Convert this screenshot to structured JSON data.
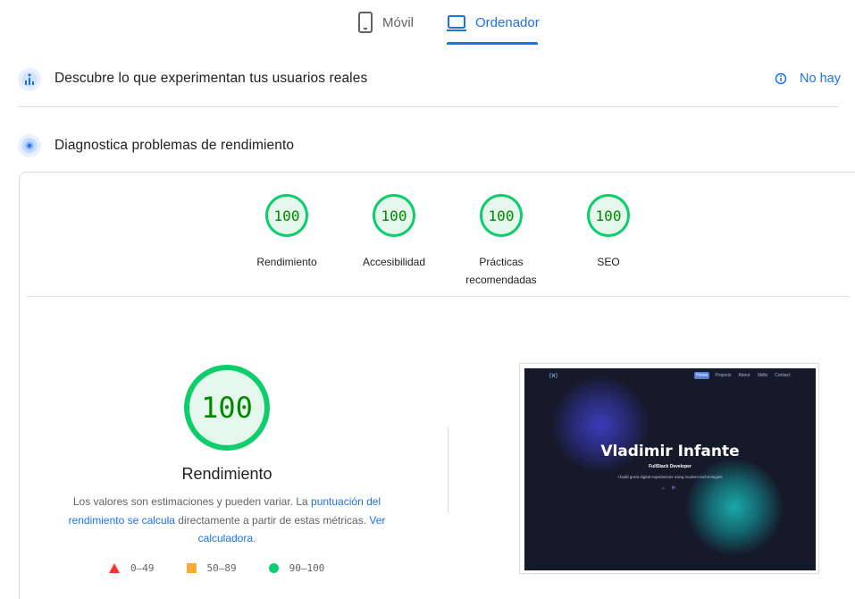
{
  "tabs": {
    "mobile": {
      "label": "Móvil",
      "icon": "smartphone-icon",
      "active": false
    },
    "desktop": {
      "label": "Ordenador",
      "icon": "laptop-icon",
      "active": true
    }
  },
  "crux": {
    "title": "Descubre lo que experimentan tus usuarios reales",
    "icon": "users-chart-icon",
    "nodata_text": "No hay",
    "nodata_icon": "info-icon"
  },
  "diagnose": {
    "title": "Diagnostica problemas de rendimiento",
    "icon": "lighthouse-icon"
  },
  "gauges": [
    {
      "score": "100",
      "label": "Rendimiento"
    },
    {
      "score": "100",
      "label": "Accesibilidad"
    },
    {
      "score": "100",
      "label": "Prácticas recomendadas"
    },
    {
      "score": "100",
      "label": "SEO"
    }
  ],
  "performance": {
    "score": "100",
    "title": "Rendimiento",
    "desc_prefix": "Los valores son estimaciones y pueden variar. La ",
    "desc_link1": "puntuación del rendimiento se calcula",
    "desc_middle": " directamente a partir de estas métricas. ",
    "desc_link2": "Ver calculadora",
    "desc_suffix": "."
  },
  "legend": [
    {
      "range": "0–49",
      "shape": "triangle",
      "color": "#ff3333"
    },
    {
      "range": "50–89",
      "shape": "square",
      "color": "#ffaa33"
    },
    {
      "range": "90–100",
      "shape": "circle",
      "color": "#0cce6b"
    }
  ],
  "preview": {
    "logo": "{W}",
    "nav": [
      "Home",
      "Projects",
      "About",
      "Skills",
      "Contact"
    ],
    "name": "Vladimir Infante",
    "role": "FullStack Developer",
    "tagline": "I build great digital experiences using modern technologies",
    "social": [
      "⌂",
      "in"
    ]
  },
  "colors": {
    "accent": "#1a73e8",
    "pass": "#0cce6b",
    "pass_text": "#008800",
    "pass_fill": "#e6f8ed"
  }
}
